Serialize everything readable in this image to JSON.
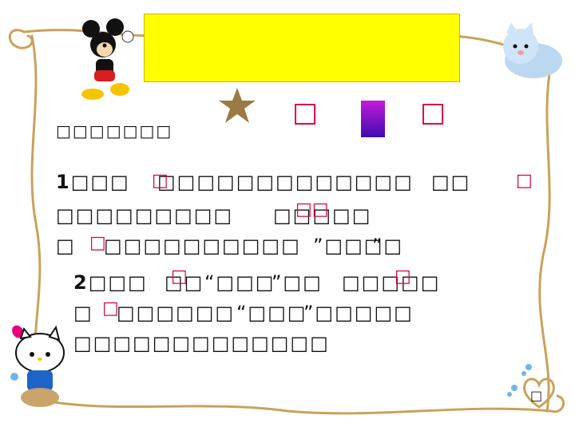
{
  "slide": {
    "accent_yellow": "#ffff00",
    "accent_red": "#d9003f",
    "frame_color": "#c9a25a",
    "heading": "□□□□□□□",
    "title_marks": [
      "□",
      "□"
    ],
    "point1": {
      "number": "1",
      "line1_a": "□□□",
      "line1_b": "□□□□□□□□□□□□□",
      "line1_c": "□□",
      "line2_a": "□□□□□□□□□",
      "line2_b": "□□□□□",
      "line3_a": "□",
      "line3_b": "□□□□□□□□□□",
      "line3_c": "”□□□",
      "line3_d": "”□"
    },
    "point2": {
      "number": "2",
      "line1_a": "□□□",
      "line1_b": "□□",
      "line1_c": "“□□□",
      "line1_d": "”□□",
      "line1_e": "□□□□□",
      "line2_a": "□",
      "line2_b": "□□□□□□",
      "line2_c": "“□□□",
      "line2_d": "”□□□□□",
      "line3": "□□□□□□□□□□□□□"
    },
    "annotations": {
      "a1": "□",
      "a2": "□",
      "a3": "□□",
      "a4": "□",
      "a5": "□",
      "a6": "□",
      "a7": "□"
    },
    "corner_mark": "□",
    "icons": [
      "mickey-mouse",
      "star",
      "cat",
      "hello-kitty",
      "heart",
      "bubbles"
    ]
  }
}
